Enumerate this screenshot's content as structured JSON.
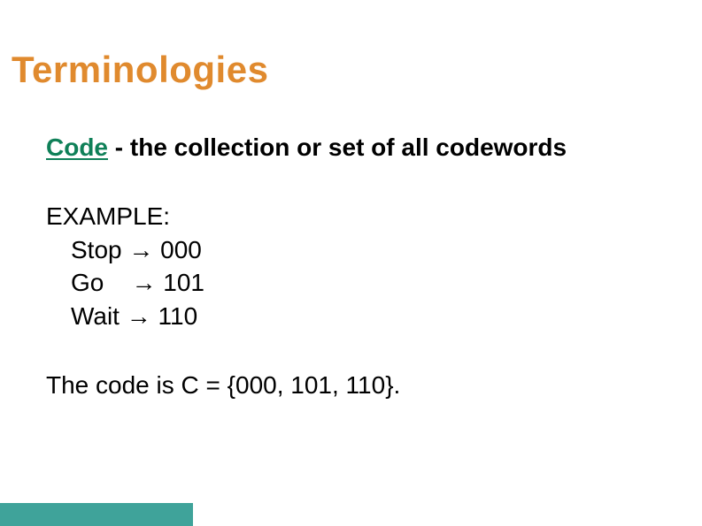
{
  "title": "Terminologies",
  "definition": {
    "term": "Code",
    "separator": " - ",
    "text": "the collection or set of all codewords"
  },
  "example": {
    "header": "EXAMPLE:",
    "mappings": [
      "Stop → 000",
      "Go    → 101",
      "Wait → 110"
    ]
  },
  "code_summary": "The code is C = {000, 101, 110}.",
  "colors": {
    "title": "#e08a2e",
    "term": "#0f8058",
    "accent_bar": "#3fa39a"
  }
}
